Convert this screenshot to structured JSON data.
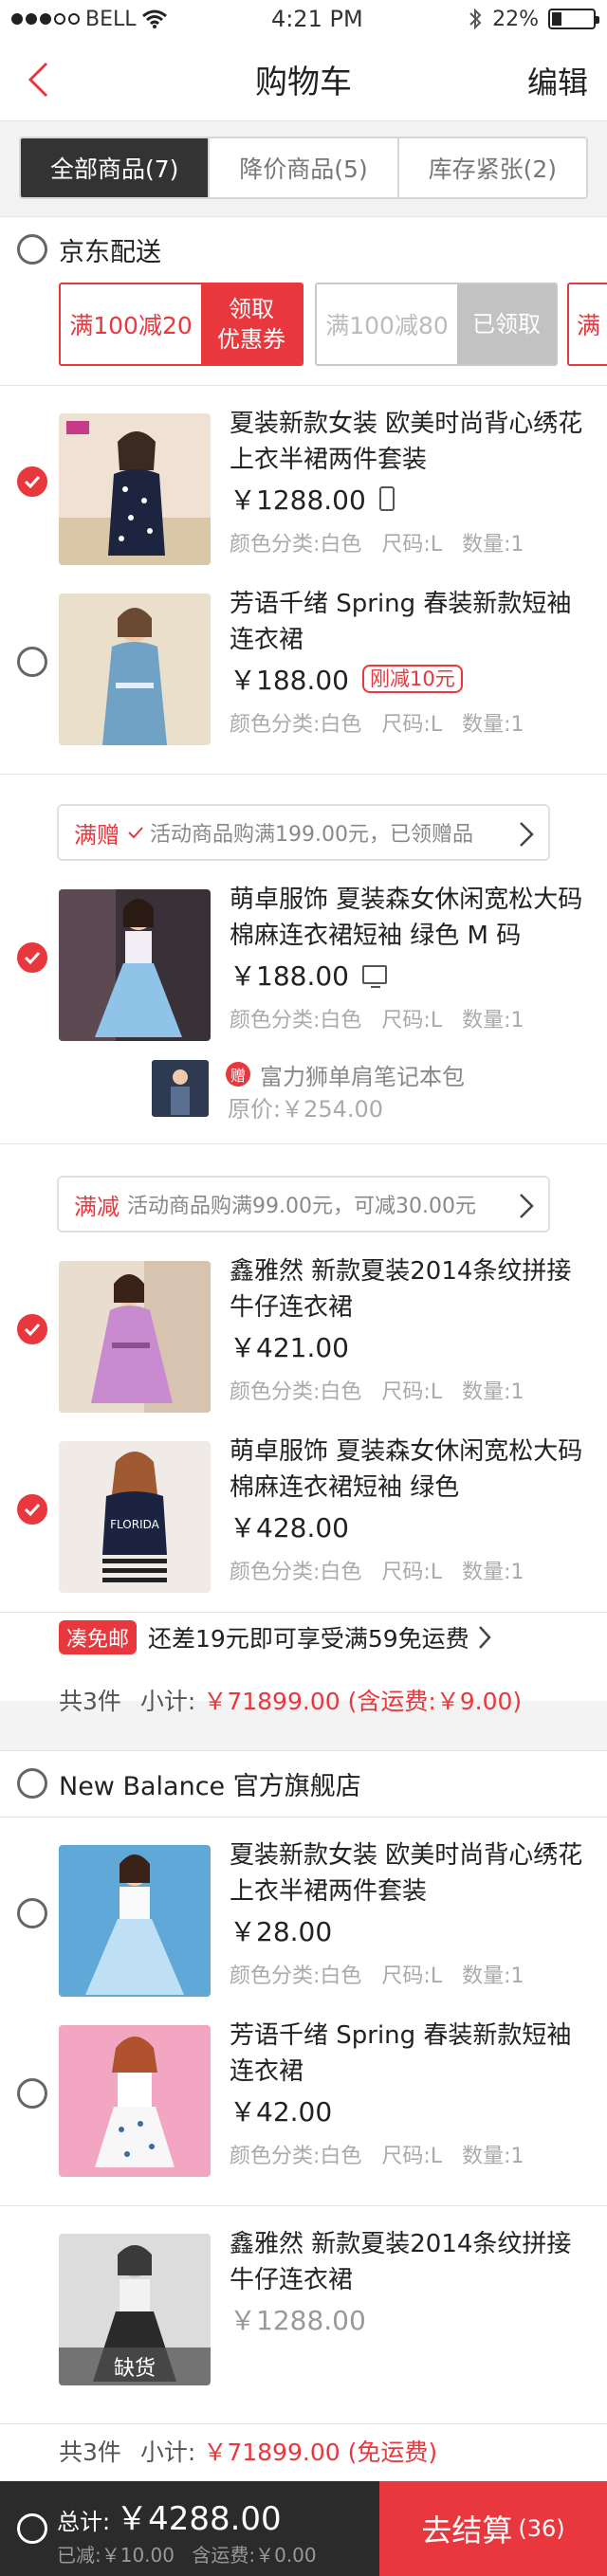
{
  "status_bar": {
    "carrier": "BELL",
    "time": "4:21 PM",
    "battery": "22%"
  },
  "nav": {
    "title": "购物车",
    "edit_label": "编辑"
  },
  "tabs": [
    {
      "label": "全部商品(7)",
      "active": true
    },
    {
      "label": "降价商品(5)",
      "active": false
    },
    {
      "label": "库存紧张(2)",
      "active": false
    }
  ],
  "shop1": {
    "name": "京东配送",
    "coupons": [
      {
        "condition": "满100减20",
        "action_line1": "领取",
        "action_line2": "优惠券",
        "state": "available"
      },
      {
        "condition": "满100减80",
        "action_line1": "已领取",
        "state": "claimed"
      },
      {
        "condition": "满"
      }
    ],
    "items": [
      {
        "title": "夏装新款女装 欧美时尚背心绣花 上衣半裙两件套装",
        "price": "￥1288.00",
        "badge_icon": "phone-icon",
        "spec_color": "颜色分类:白色",
        "spec_size": "尺码:L",
        "spec_qty": "数量:1",
        "checked": true
      },
      {
        "title": "芳语千绪 Spring 春装新款短袖连衣裙",
        "price": "￥188.00",
        "badge": "刚减10元",
        "spec_color": "颜色分类:白色",
        "spec_size": "尺码:L",
        "spec_qty": "数量:1",
        "checked": false
      }
    ],
    "promo_gift": {
      "tag": "满赠",
      "text": "活动商品购满199.00元，已领赠品"
    },
    "gift_item": {
      "title": "萌卓服饰 夏装森女休闲宽松大码棉麻连衣裙短袖 绿色 M 码",
      "price": "￥188.00",
      "badge_icon": "monitor-icon",
      "spec_color": "颜色分类:白色",
      "spec_size": "尺码:L",
      "spec_qty": "数量:1",
      "checked": true
    },
    "gift": {
      "icon": "赠",
      "name": "富力狮单肩笔记本包",
      "original_price": "原价:￥254.00"
    },
    "promo_discount": {
      "tag": "满减",
      "text": "活动商品购满99.00元，可减30.00元"
    },
    "discount_items": [
      {
        "title": "鑫雅然 新款夏装2014条纹拼接牛仔连衣裙",
        "price": "￥421.00",
        "spec_color": "颜色分类:白色",
        "spec_size": "尺码:L",
        "spec_qty": "数量:1",
        "checked": true
      },
      {
        "title": "萌卓服饰 夏装森女休闲宽松大码棉麻连衣裙短袖 绿色",
        "price": "￥428.00",
        "spec_color": "颜色分类:白色",
        "spec_size": "尺码:L",
        "spec_qty": "数量:1",
        "checked": true
      }
    ],
    "free_shipping": {
      "tag": "凑免邮",
      "text": "还差19元即可享受满59免运费"
    },
    "subtotal": {
      "count": "共3件",
      "label": "小计:",
      "amount": "￥71899.00 (含运费:￥9.00)"
    }
  },
  "shop2": {
    "name": "New Balance 官方旗舰店",
    "items": [
      {
        "title": "夏装新款女装 欧美时尚背心绣花 上衣半裙两件套装",
        "price": "￥28.00",
        "spec_color": "颜色分类:白色",
        "spec_size": "尺码:L",
        "spec_qty": "数量:1",
        "checked": false
      },
      {
        "title": "芳语千绪 Spring 春装新款短袖连衣裙",
        "price": "￥42.00",
        "spec_color": "颜色分类:白色",
        "spec_size": "尺码:L",
        "spec_qty": "数量:1",
        "checked": false
      },
      {
        "title": "鑫雅然 新款夏装2014条纹拼接牛仔连衣裙",
        "price": "￥1288.00",
        "out_of_stock": "缺货"
      }
    ],
    "subtotal": {
      "count": "共3件",
      "label": "小计:",
      "amount": "￥71899.00 (免运费)"
    }
  },
  "bottom": {
    "total_label": "总计:",
    "total_amount": "￥4288.00",
    "saved": "已减:￥10.00",
    "shipping": "含运费:￥0.00",
    "checkout_label": "去结算",
    "checkout_count": "(36)"
  },
  "colors": {
    "accent": "#e8383d",
    "dark": "#2b2b2b"
  }
}
